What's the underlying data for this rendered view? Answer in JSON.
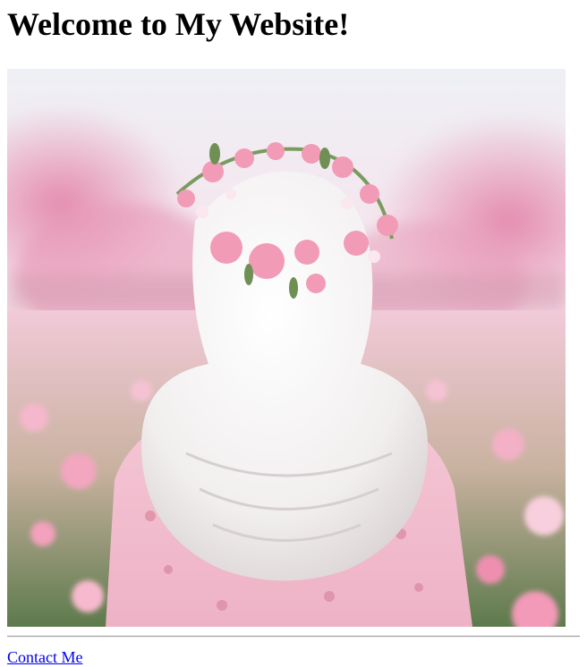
{
  "page": {
    "title": "Welcome to My Website!"
  },
  "hero": {
    "image_icon": "photo-illustration",
    "colors": {
      "sky": "#f3e6ee",
      "blossom": "#f0a9c4",
      "hijab": "#f4f2f2",
      "dress": "#f6c9d8",
      "field": "#6b8a5a"
    }
  },
  "footer": {
    "contact_label": "Contact Me",
    "link_color": "#0000ee"
  }
}
